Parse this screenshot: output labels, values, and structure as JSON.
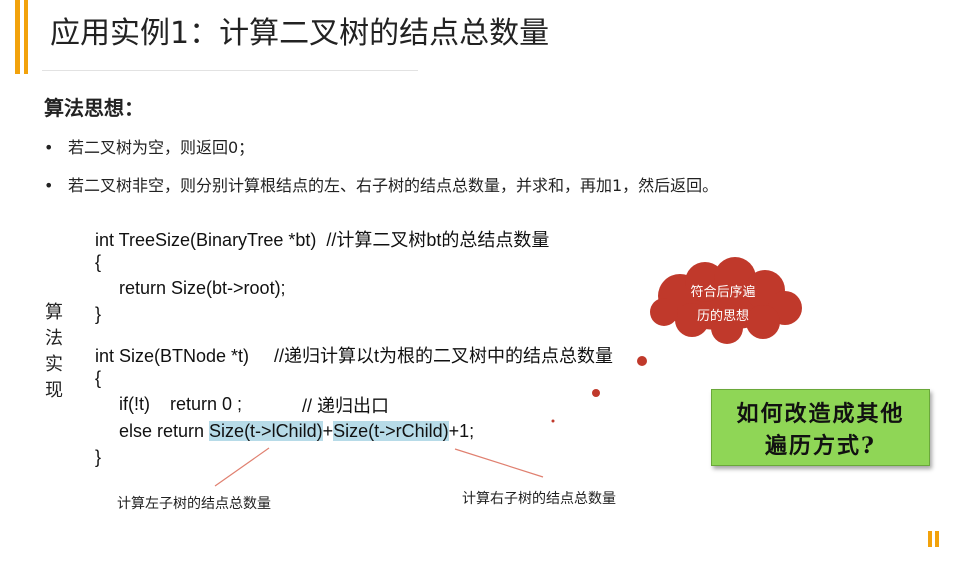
{
  "title": "应用实例1：计算二叉树的结点总数量",
  "heading": "算法思想：",
  "bullets": [
    "若二叉树为空，则返回0；",
    "若二叉树非空，则分别计算根结点的左、右子树的结点总数量，并求和，再加1，然后返回。"
  ],
  "side_label": "算法实现",
  "code": {
    "line1": "int TreeSize(BinaryTree *bt)  //计算二叉树bt的总结点数量",
    "line2": "{",
    "line3": "return Size(bt->root);",
    "line4": "}",
    "line5": "int Size(BTNode *t)     //递归计算以t为根的二叉树中的结点总数量",
    "line6": "{",
    "line7a": "if(!t)    return 0 ;",
    "line7b": "// 递归出口",
    "line8_prefix": "else return ",
    "line8_left": "Size(t->lChild)",
    "line8_plus": "+",
    "line8_right": "Size(t->rChild)",
    "line8_suffix": "+1;",
    "line9": "}"
  },
  "annotations": {
    "left_subtree": "计算左子树的结点总数量",
    "right_subtree": "计算右子树的结点总数量"
  },
  "cloud": {
    "line1": "符合后序遍",
    "line2": "历的思想",
    "color": "#c0392b"
  },
  "question_box": {
    "line1": "如何改造成其他",
    "line2": "遍历方式?",
    "color": "#8fd656"
  },
  "accent_color": "#f2a20c",
  "highlight_color": "#b7dbe8"
}
